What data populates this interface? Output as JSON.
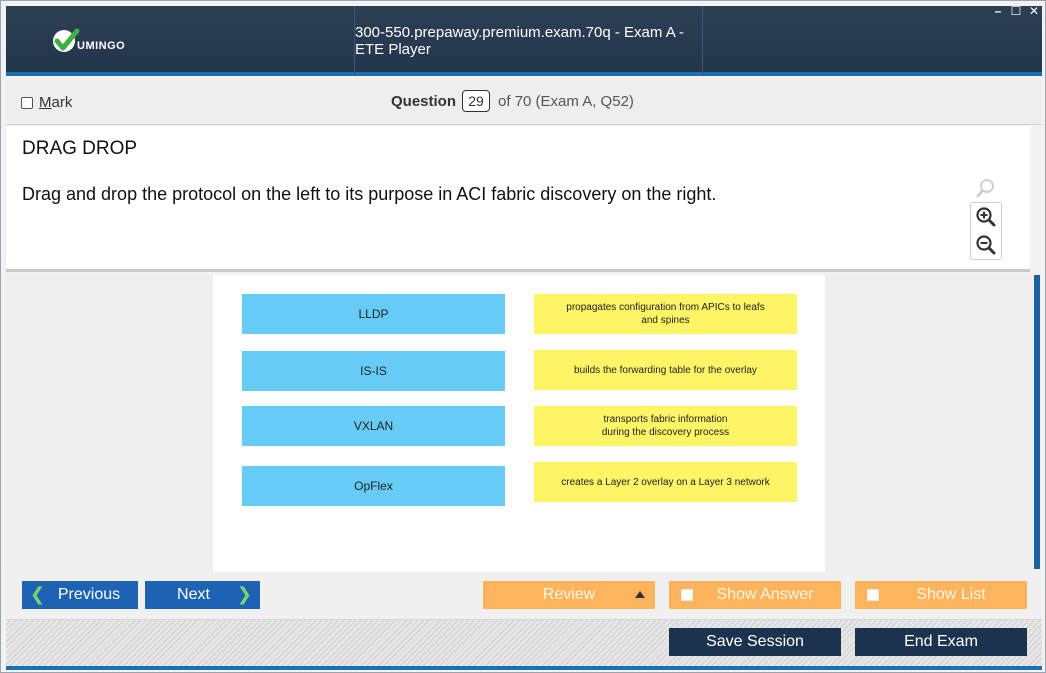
{
  "window": {
    "title": "300-550.prepaway.premium.exam.70q - Exam A - ETE Player",
    "logo_text": "UMINGO",
    "controls": {
      "minimize": "–",
      "maximize": "☐",
      "close": "✕"
    }
  },
  "question_bar": {
    "mark_label_first": "M",
    "mark_label_rest": "ark",
    "question_label": "Question",
    "current_number": "29",
    "of_text": "of 70 (Exam A, Q52)"
  },
  "question": {
    "type": "DRAG DROP",
    "text": "Drag and drop the protocol on the left to its purpose in ACI fabric discovery on the right."
  },
  "exhibit": {
    "drag_items": [
      {
        "label": "LLDP"
      },
      {
        "label": "IS-IS"
      },
      {
        "label": "VXLAN"
      },
      {
        "label": "OpFlex"
      }
    ],
    "targets": [
      {
        "label": "propagates configuration from APICs to leafs\nand spines"
      },
      {
        "label": "builds the forwarding table for the overlay"
      },
      {
        "label": "transports fabric information\nduring the discovery process"
      },
      {
        "label": "creates a Layer 2 overlay on a Layer 3 network"
      }
    ]
  },
  "nav": {
    "previous_label": "Previous",
    "next_label": "Next",
    "review_label": "Review",
    "show_answer_label": "Show Answer",
    "show_list_label": "Show List",
    "save_session_label": "Save Session",
    "end_exam_label": "End Exam"
  },
  "colors": {
    "titlebar": "#2c3f55",
    "accent_blue": "#1e63b3",
    "orange": "#fdb45c",
    "dark_button": "#1c3350",
    "drag_blue": "#66ccf5",
    "target_yellow": "#fdf566",
    "chevron_green": "#7fd36a"
  }
}
